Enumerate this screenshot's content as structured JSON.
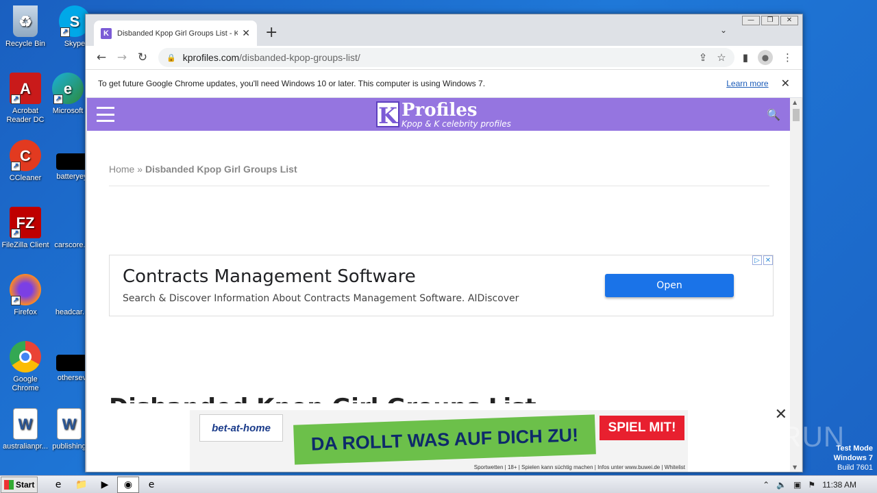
{
  "desktop": {
    "icons": [
      {
        "label": "Recycle Bin"
      },
      {
        "label": "Skype"
      },
      {
        "label": "Acrobat Reader DC"
      },
      {
        "label": "Microsoft"
      },
      {
        "label": "CCleaner"
      },
      {
        "label": "batteryey"
      },
      {
        "label": "FileZilla Client"
      },
      {
        "label": "carscore..."
      },
      {
        "label": "Firefox"
      },
      {
        "label": "headcar..."
      },
      {
        "label": "Google Chrome"
      },
      {
        "label": "othersev"
      },
      {
        "label": "australianpr..."
      },
      {
        "label": "publishing"
      }
    ]
  },
  "browser": {
    "tab": {
      "title": "Disbanded Kpop Girl Groups List - Kp",
      "favicon": "K"
    },
    "address": {
      "domain": "kprofiles.com",
      "path": "/disbanded-kpop-groups-list/"
    },
    "infobar": {
      "message": "To get future Google Chrome updates, you'll need Windows 10 or later. This computer is using Windows 7.",
      "link": "Learn more"
    }
  },
  "site": {
    "logo": {
      "letter": "K",
      "name": "Profiles",
      "tagline": "Kpop & K celebrity profiles"
    },
    "breadcrumb": {
      "home": "Home",
      "sep": " » ",
      "current": "Disbanded Kpop Girl Groups List"
    },
    "ad": {
      "title": "Contracts Management Software",
      "description": "Search & Discover Information About Contracts Management Software. AIDiscover",
      "button": "Open"
    },
    "heading": "Disbanded Kpop Girl Groups List",
    "banner": {
      "brand": "bet-at-home",
      "slogan": "DA ROLLT WAS AUF DICH ZU!",
      "cta": "SPIEL MIT!",
      "disclaimer": "Sportwetten | 18+ | Spielen kann süchtig machen | Infos unter www.buwei.de | Whitelist"
    }
  },
  "watermark": {
    "text": "ANY RUN",
    "line1": "Test Mode",
    "line2": "Windows 7",
    "line3": "Build 7601"
  },
  "taskbar": {
    "start": "Start",
    "clock": "11:38 AM"
  },
  "colors": {
    "site_header": "#9575e0",
    "ad_button": "#1a73e8",
    "banner_green": "#6cc04a",
    "banner_red": "#e8202f"
  }
}
